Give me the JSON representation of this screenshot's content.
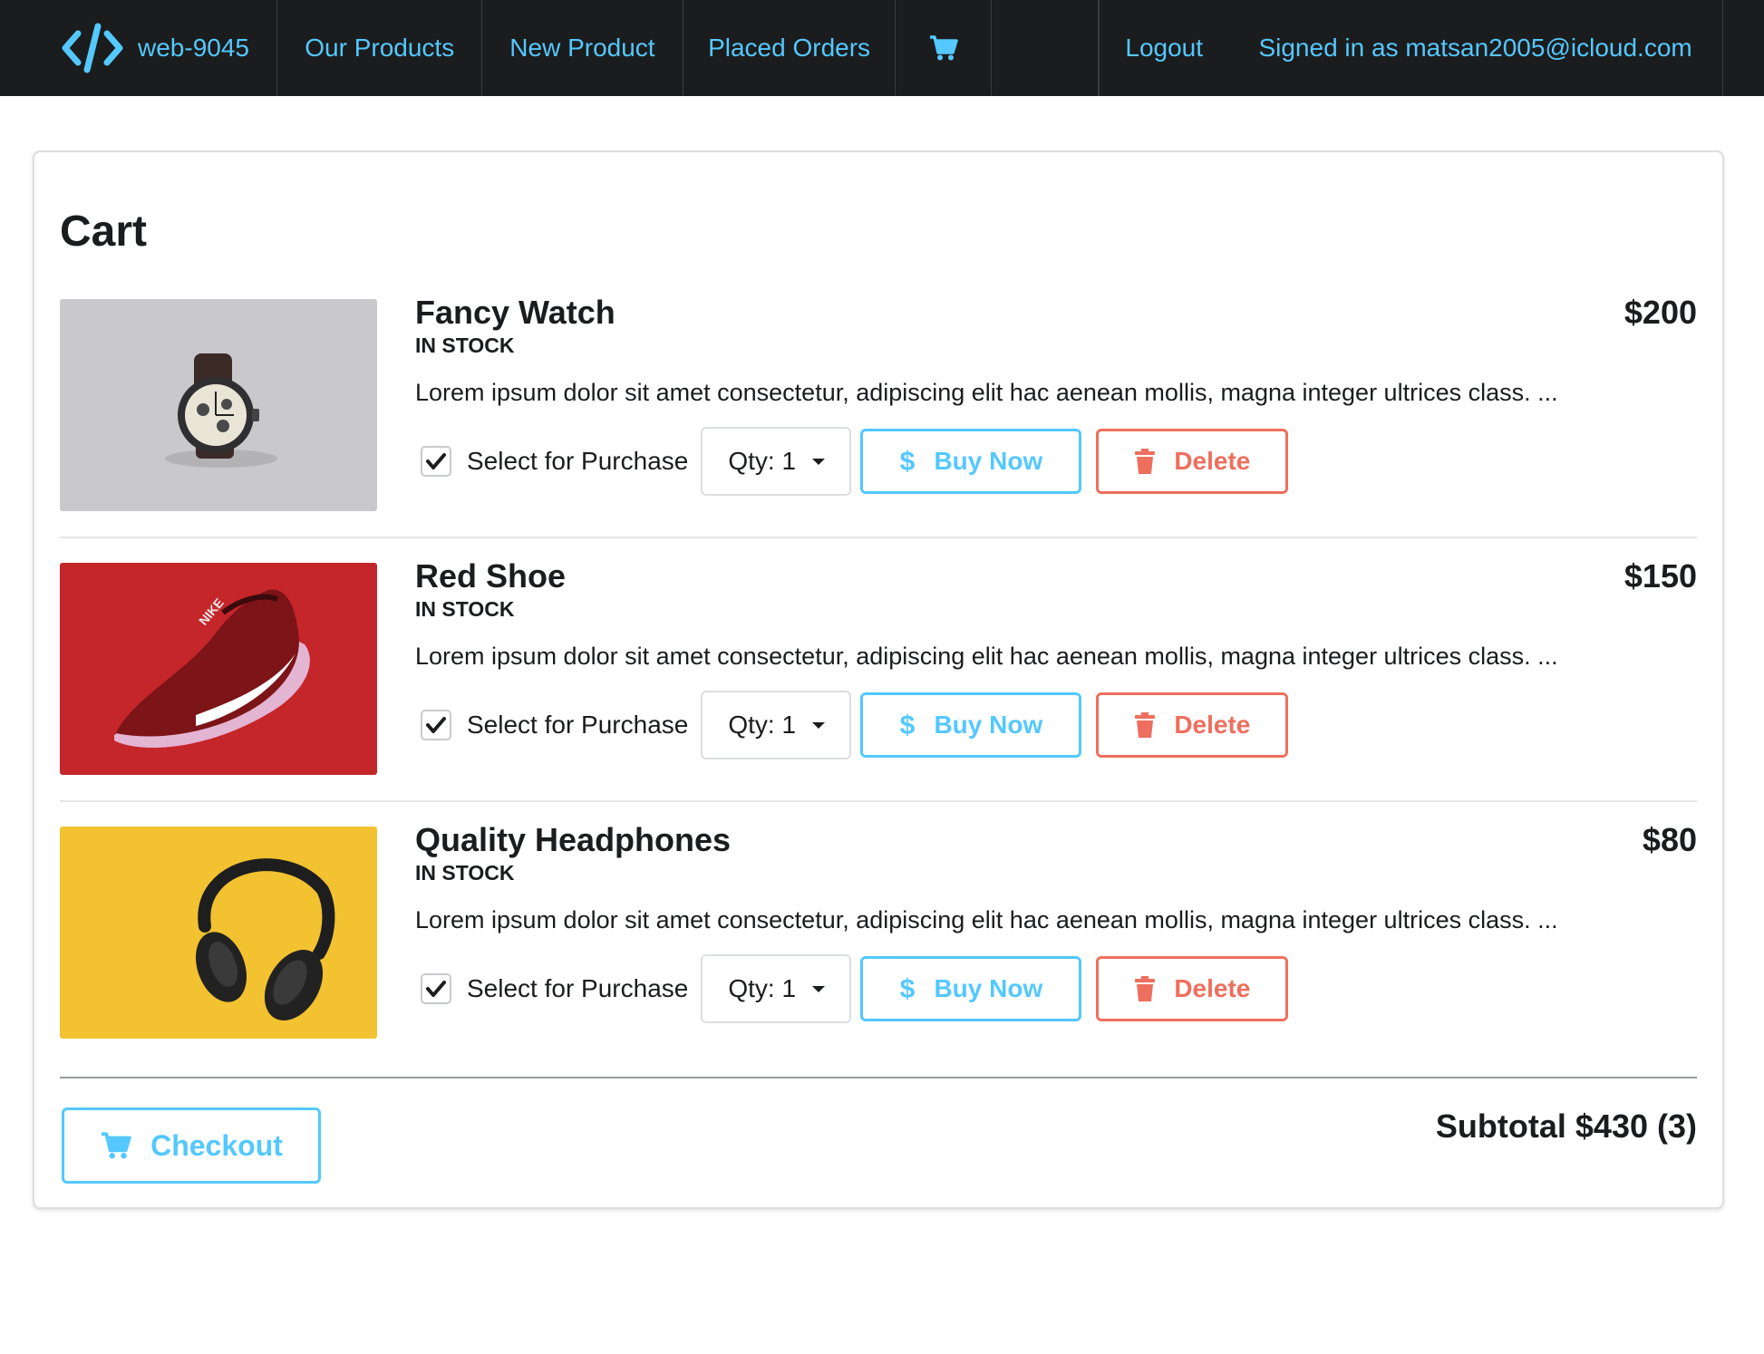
{
  "nav": {
    "brand": "web-9045",
    "our_products": "Our Products",
    "new_product": "New Product",
    "placed_orders": "Placed Orders",
    "logout": "Logout",
    "signed_in": "Signed in as matsan2005@icloud.com",
    "link_color": "#54c8ff",
    "bg_color": "#1b1c1d"
  },
  "cart": {
    "title": "Cart",
    "select_label": "Select for Purchase",
    "buy_label": "Buy Now",
    "delete_label": "Delete",
    "items": [
      {
        "name": "Fancy Watch",
        "stock": "IN STOCK",
        "price": "$200",
        "description": "Lorem ipsum dolor sit amet consectetur, adipiscing elit hac aenean mollis, magna integer ultrices class. ...",
        "qty": "Qty: 1",
        "selected": true,
        "image": "watch"
      },
      {
        "name": "Red Shoe",
        "stock": "IN STOCK",
        "price": "$150",
        "description": "Lorem ipsum dolor sit amet consectetur, adipiscing elit hac aenean mollis, magna integer ultrices class. ...",
        "qty": "Qty: 1",
        "selected": true,
        "image": "shoe"
      },
      {
        "name": "Quality Headphones",
        "stock": "IN STOCK",
        "price": "$80",
        "description": "Lorem ipsum dolor sit amet consectetur, adipiscing elit hac aenean mollis, magna integer ultrices class. ...",
        "qty": "Qty: 1",
        "selected": true,
        "image": "headphones"
      }
    ],
    "checkout_label": "Checkout",
    "subtotal": "Subtotal $430 (3)",
    "colors": {
      "buy": "#54c8ff",
      "delete": "#ee6f5e"
    }
  }
}
